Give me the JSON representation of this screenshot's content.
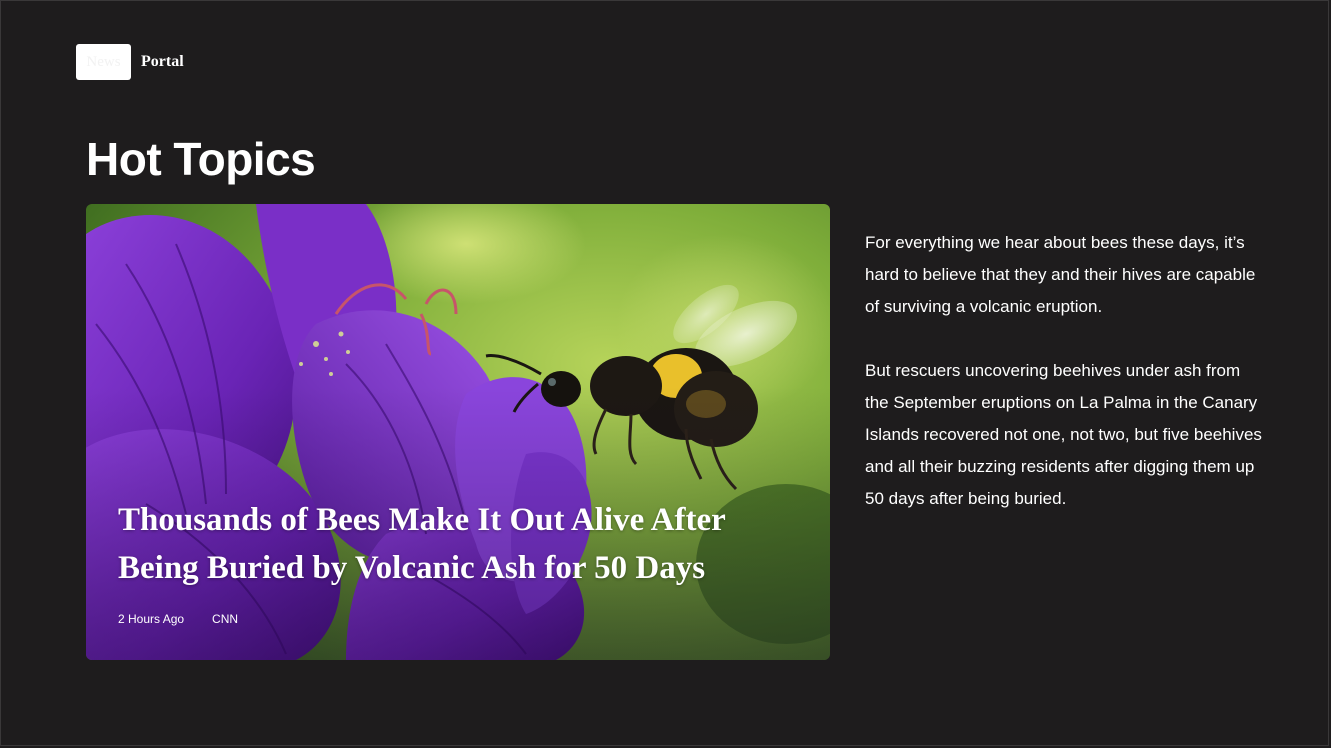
{
  "header": {
    "logo_text": "News",
    "site_name": "Portal"
  },
  "section": {
    "title": "Hot Topics"
  },
  "featured": {
    "headline": "Thousands of Bees Make It Out Alive After Being Buried by Volcanic Ash for 50 Days",
    "time_ago": "2 Hours Ago",
    "source": "CNN",
    "image_subject": "bumblebee-on-purple-geranium-photo"
  },
  "article": {
    "paragraphs": [
      "For everything we hear about bees these days, it’s hard to believe that they and their hives are capable of surviving a volcanic eruption.",
      "But rescuers uncovering beehives under ash from the September eruptions on La Palma in the Canary Islands recovered not one, not two, but five beehives and all their buzzing residents after digging them up 50 days after being buried."
    ]
  },
  "colors": {
    "background": "#1e1c1d",
    "text": "#ffffff",
    "logo_box": "#ffffff"
  }
}
